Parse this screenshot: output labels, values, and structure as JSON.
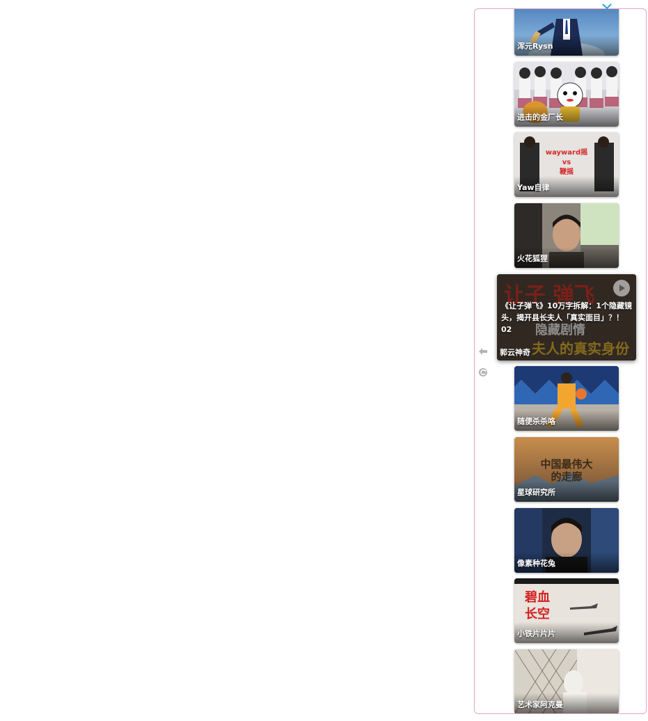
{
  "panel": {
    "close_icon": "close-icon",
    "side_icons": [
      "back-arrow-icon",
      "refresh-icon"
    ]
  },
  "active_video": {
    "title": "《让子弹飞》10万字拆解：1个隐藏镜头，揭开县长夫人「真实面目」？！ 02",
    "author": "郭云神奇",
    "thumbnail_text_top": "让子 弹飞",
    "thumbnail_text_mid": "隐藏剧情",
    "thumbnail_text_bottom": "夫人的真实身份"
  },
  "videos_above": [
    {
      "author": "浑元Rysn"
    },
    {
      "author": "进击的金厂长"
    },
    {
      "author": "Yaw自律",
      "thumb_text": "wayward摇 vs 鞭摇"
    },
    {
      "author": "火花狐狸"
    }
  ],
  "videos_below": [
    {
      "author": "随便杀杀咯"
    },
    {
      "author": "星球研究所",
      "thumb_text": "中国最伟大的走廊"
    },
    {
      "author": "像素种花兔"
    },
    {
      "author": "小铁片片片",
      "thumb_text": "碧血长空"
    },
    {
      "author": "艺术家阿克曼"
    }
  ]
}
